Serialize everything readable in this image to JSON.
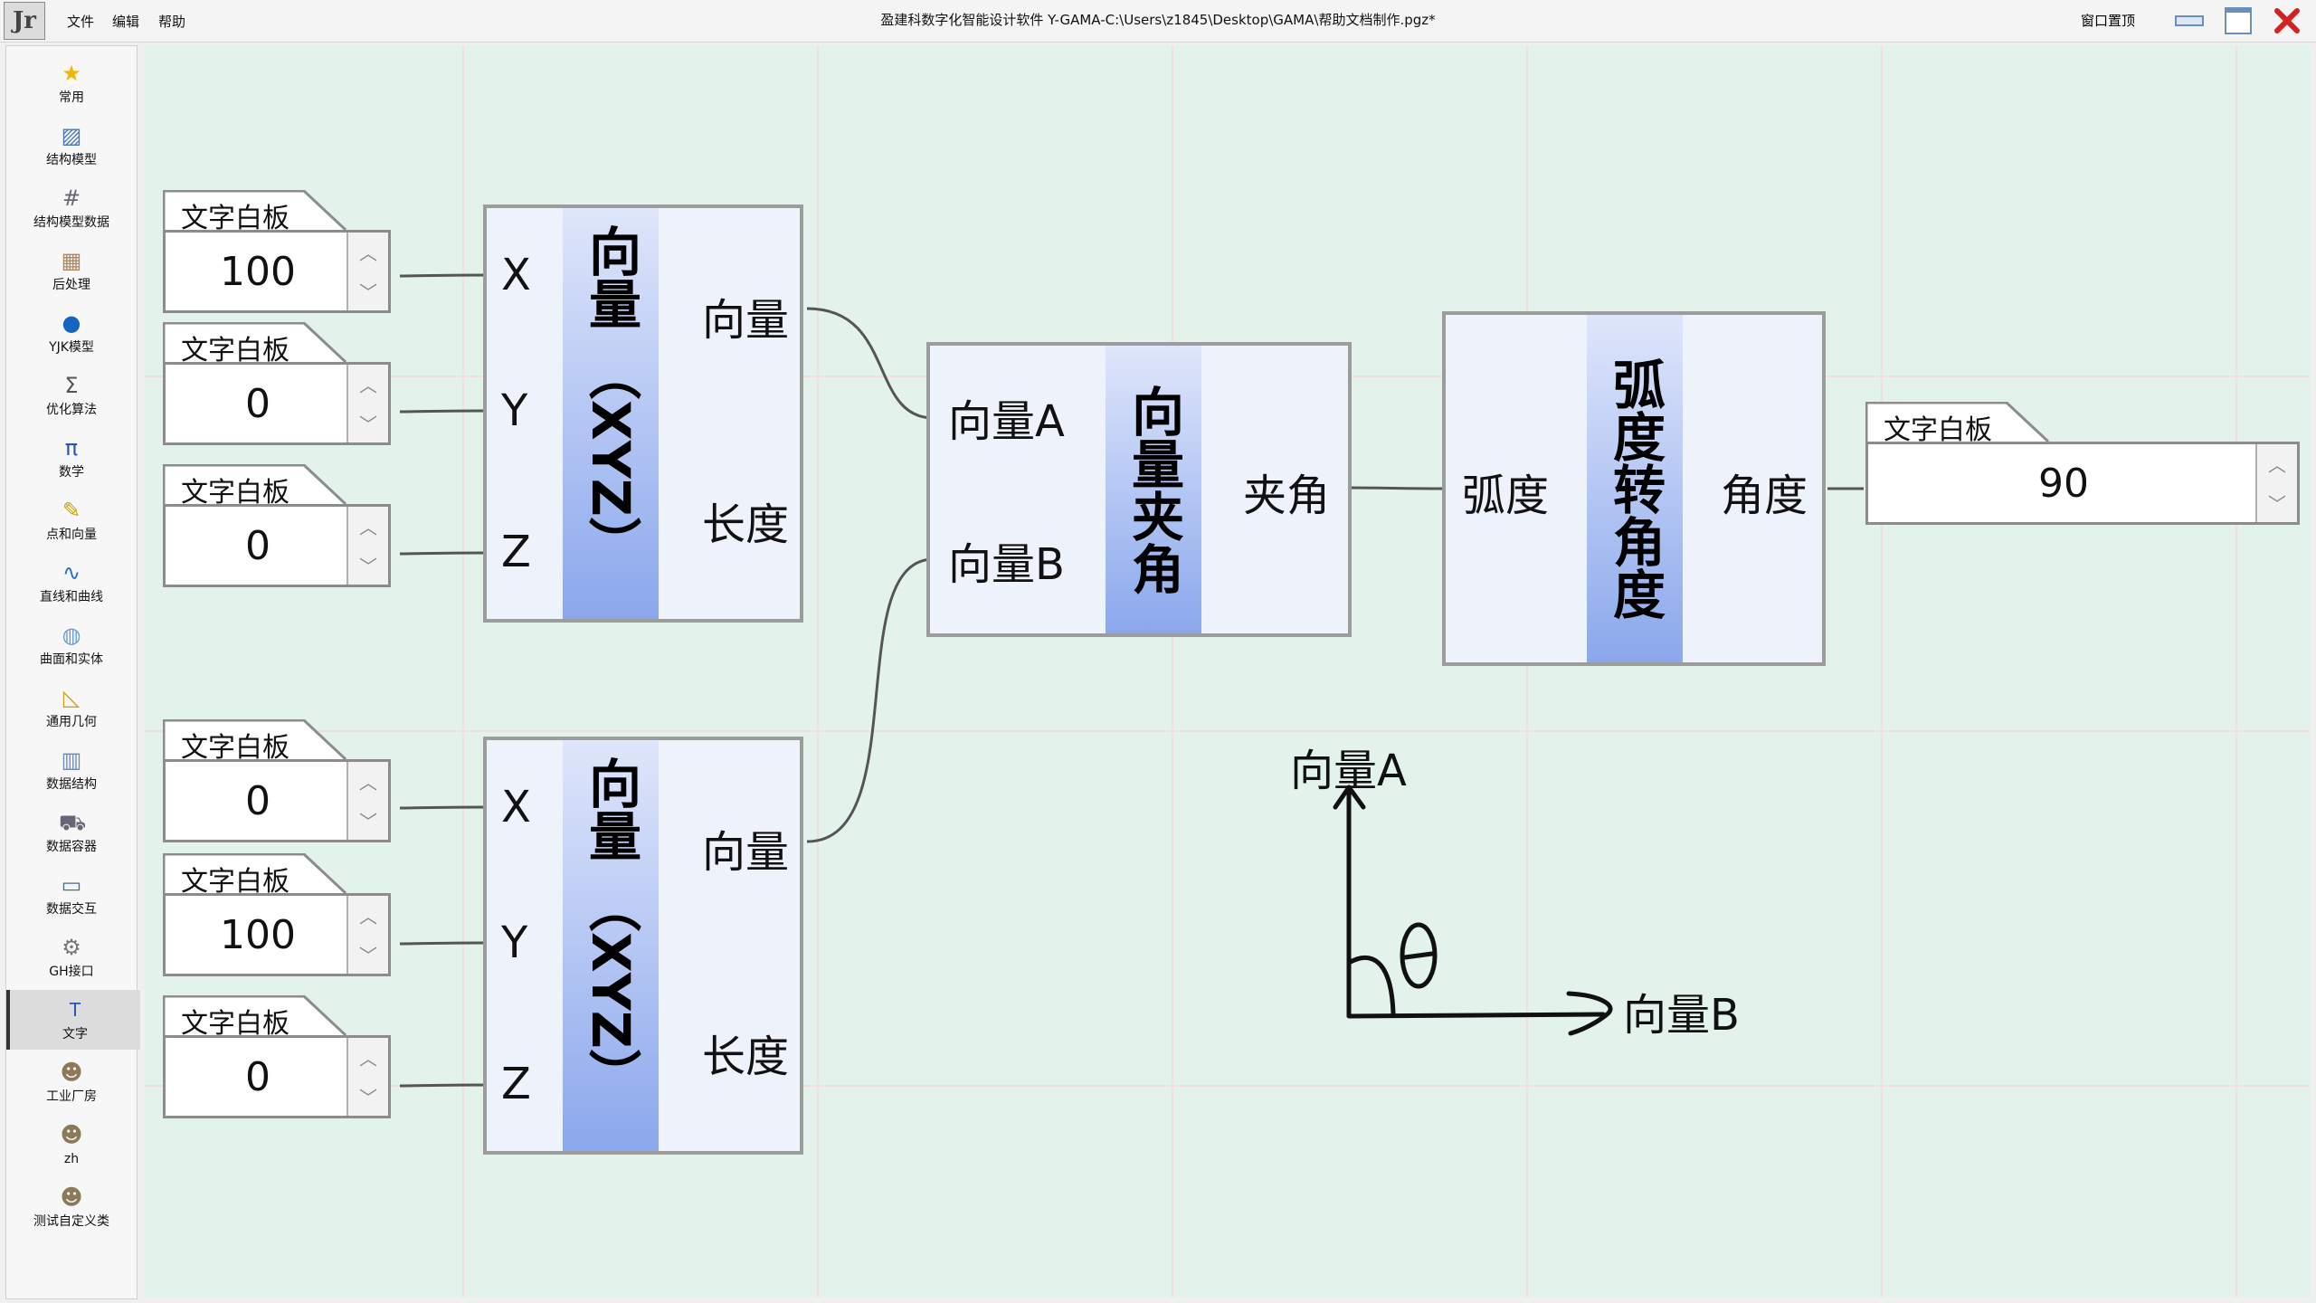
{
  "app": {
    "logo": "Jr",
    "menu": [
      "文件",
      "编辑",
      "帮助"
    ],
    "title": "盈建科数字化智能设计软件  Y-GAMA-C:\\Users\\z1845\\Desktop\\GAMA\\帮助文档制作.pgz*",
    "window_top_label": "窗口置顶"
  },
  "sidebar": {
    "items": [
      {
        "label": "常用",
        "icon": "star-icon"
      },
      {
        "label": "结构模型",
        "icon": "structure-model-icon"
      },
      {
        "label": "结构模型数据",
        "icon": "grid-icon"
      },
      {
        "label": "后处理",
        "icon": "postprocess-icon"
      },
      {
        "label": "YJK模型",
        "icon": "yjk-icon"
      },
      {
        "label": "优化算法",
        "icon": "sigma-icon"
      },
      {
        "label": "数学",
        "icon": "pi-icon"
      },
      {
        "label": "点和向量",
        "icon": "point-vector-icon"
      },
      {
        "label": "直线和曲线",
        "icon": "curve-icon"
      },
      {
        "label": "曲面和实体",
        "icon": "surface-icon"
      },
      {
        "label": "通用几何",
        "icon": "ruler-icon"
      },
      {
        "label": "数据结构",
        "icon": "data-structure-icon"
      },
      {
        "label": "数据容器",
        "icon": "cart-icon"
      },
      {
        "label": "数据交互",
        "icon": "monitor-icon"
      },
      {
        "label": "GH接口",
        "icon": "gh-icon"
      },
      {
        "label": "文字",
        "icon": "text-icon"
      },
      {
        "label": "工业厂房",
        "icon": "cat-icon"
      },
      {
        "label": "zh",
        "icon": "cat-icon"
      },
      {
        "label": "测试自定义类",
        "icon": "cat-icon"
      }
    ],
    "active_index": 15
  },
  "canvas": {
    "panels": [
      {
        "tab": "文字白板",
        "value": "100"
      },
      {
        "tab": "文字白板",
        "value": "0"
      },
      {
        "tab": "文字白板",
        "value": "0"
      },
      {
        "tab": "文字白板",
        "value": "0"
      },
      {
        "tab": "文字白板",
        "value": "100"
      },
      {
        "tab": "文字白板",
        "value": "0"
      },
      {
        "tab": "文字白板",
        "value": "90"
      }
    ],
    "vector_node_1": {
      "name": "向量（XYZ）",
      "name_a": "向量",
      "name_b": "（XYZ）",
      "inputs": [
        "X",
        "Y",
        "Z"
      ],
      "outputs": [
        "向量",
        "长度"
      ]
    },
    "vector_node_2": {
      "name": "向量（XYZ）",
      "name_a": "向量",
      "name_b": "（XYZ）",
      "inputs": [
        "X",
        "Y",
        "Z"
      ],
      "outputs": [
        "向量",
        "长度"
      ]
    },
    "angle_node": {
      "name": "向量夹角",
      "inputs": [
        "向量A",
        "向量B"
      ],
      "outputs": [
        "夹角"
      ]
    },
    "convert_node": {
      "name": "弧度转角度",
      "inputs": [
        "弧度"
      ],
      "outputs": [
        "角度"
      ]
    },
    "sketch": {
      "label_a": "向量A",
      "label_b": "向量B",
      "theta": "θ"
    }
  },
  "colors": {
    "canvas_bg": "#e4f2ec",
    "node_bg": "#eef2fb",
    "node_accent": "#8ba8ec",
    "close_red": "#d22222"
  }
}
